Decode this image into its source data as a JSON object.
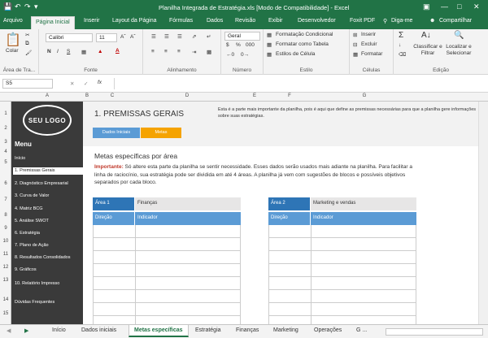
{
  "window": {
    "title": "Planilha Integrada de Estratégia.xls [Modo de Compatibilidade] - Excel",
    "tell_me": "Diga-me",
    "share": "Compartilhar"
  },
  "ribbon_tabs": [
    "Arquivo",
    "Página Inicial",
    "Inserir",
    "Layout da Página",
    "Fórmulas",
    "Dados",
    "Revisão",
    "Exibir",
    "Desenvolvedor",
    "Foxit PDF"
  ],
  "ribbon": {
    "paste_label": "Colar",
    "clipboard_label": "Área de Tra...",
    "font_name": "Calibri",
    "font_size": "11",
    "bold": "N",
    "italic": "I",
    "underline": "S",
    "font_label": "Fonte",
    "alignment_label": "Alinhamento",
    "number_format": "Geral",
    "number_label": "Número",
    "cond_format": "Formatação Condicional",
    "format_table": "Formatar como Tabela",
    "cell_styles": "Estilos de Célula",
    "styles_label": "Estilo",
    "insert": "Inserir",
    "delete": "Excluir",
    "format": "Formatar",
    "cells_label": "Células",
    "sort_filter": "Classificar e Filtrar",
    "find_select": "Localizar e Selecionar",
    "edit_label": "Edição"
  },
  "formula_bar": {
    "name_box": "S5",
    "fx": "fx",
    "value": ""
  },
  "columns": [
    "A",
    "B",
    "C",
    "D",
    "E",
    "F",
    "G"
  ],
  "rows": [
    "1",
    "2",
    "3",
    "4",
    "5",
    "6",
    "7",
    "8",
    "9",
    "10",
    "11",
    "12",
    "13",
    "14",
    "15"
  ],
  "sidebar": {
    "logo": "SEU LOGO",
    "menu_title": "Menu",
    "items": [
      "Início",
      "1. Premissas Gerais",
      "2. Diagnóstico Empresarial",
      "3. Curva de Valor",
      "4. Matriz BCG",
      "5. Análise SWOT",
      "6. Estratégia",
      "7. Plano de Ação",
      "8. Resultados Consolidados",
      "9. Gráficos",
      "10. Relatório Impresso",
      "Dúvidas Frequentes"
    ]
  },
  "sheet": {
    "title": "1. PREMISSAS GERAIS",
    "intro": "Esta é a parte mais importante da planilha, pois é aqui que  define as premissas necessárias para que  a planilha gere informações sobre suas estratégias.",
    "subtabs": [
      "Dados Iniciais",
      "Metas"
    ],
    "section_title": "Metas específicas por área",
    "important_label": "Importante:",
    "important_text": " Só altere esta parte da planilha se sentir necessidade. Esses dados serão usados mais adiante na planilha. Para facilitar a linha de raciocínio, sua estratégia pode ser dividida em até 4 áreas. A planilha já vem com sugestões de blocos e possíveis objetivos separados por cada bloco.",
    "areas": [
      {
        "label": "Área 1",
        "name": "Finanças",
        "col1": "Direção",
        "col2": "Indicador"
      },
      {
        "label": "Área 2",
        "name": "Marketing e vendas",
        "col1": "Direção",
        "col2": "Indicador"
      }
    ]
  },
  "sheet_tabs": [
    "Início",
    "Dados iniciais",
    "Metas específicas",
    "Estratégia",
    "Finanças",
    "Marketing",
    "Operações",
    "G ..."
  ],
  "colors": {
    "excel_green": "#217346",
    "blue": "#5b9bd5",
    "dark_blue": "#2e75b6",
    "orange": "#f5a300",
    "sidebar": "#3a3a3a",
    "important_red": "#c0392b"
  }
}
